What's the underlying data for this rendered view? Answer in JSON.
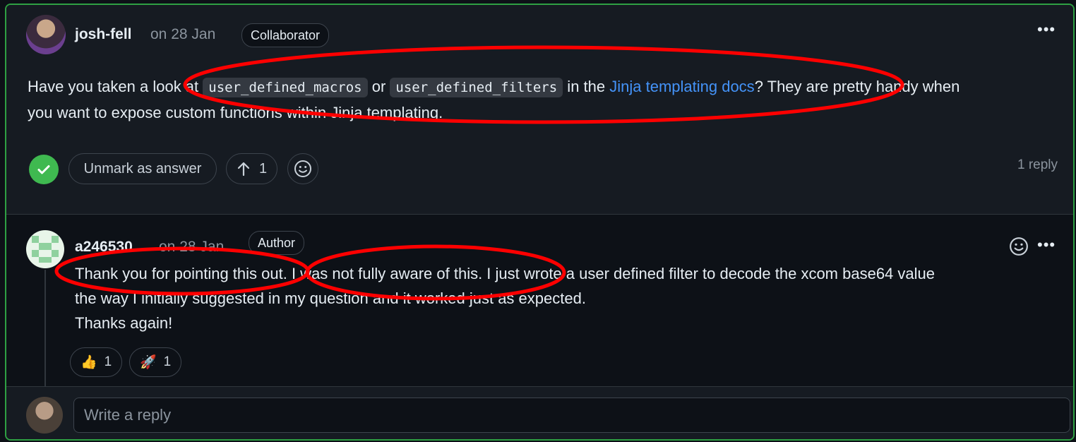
{
  "comment": {
    "username": "josh-fell",
    "date": "on 28 Jan",
    "role": "Collaborator",
    "more_icon": "kebab-horizontal-icon",
    "line1_pre": "Have you taken a look at ",
    "code1": "user_defined_macros",
    "mid1": " or ",
    "code2": "user_defined_filters",
    "mid2": " in the ",
    "link_text": "Jinja templating docs",
    "line1_post": "? They are pretty handy when",
    "line2": "you want to expose custom functions within Jinja templating.",
    "answer_icon": "check-circle-icon",
    "unmark_label": "Unmark as answer",
    "upvote_icon": "arrow-up-icon",
    "upvote_count": "1",
    "emoji_icon": "smiley-icon",
    "reply_count": "1 reply"
  },
  "reply": {
    "username": "a246530",
    "date": "on 28 Jan",
    "role": "Author",
    "emoji_icon": "smiley-icon",
    "more_icon": "kebab-horizontal-icon",
    "line1": "Thank you for pointing this out. I was not fully aware of this. I just wrote a user defined filter to decode the xcom base64 value",
    "line2": "the way I initially suggested in my question and it worked just as expected.",
    "line3": "Thanks again!",
    "reactions": [
      {
        "emoji": "👍",
        "count": "1"
      },
      {
        "emoji": "🚀",
        "count": "1"
      }
    ]
  },
  "reply_box": {
    "placeholder": "Write a reply"
  },
  "colors": {
    "answered_border": "#2ea043",
    "link": "#4493f8",
    "annotation": "#ff0000"
  }
}
